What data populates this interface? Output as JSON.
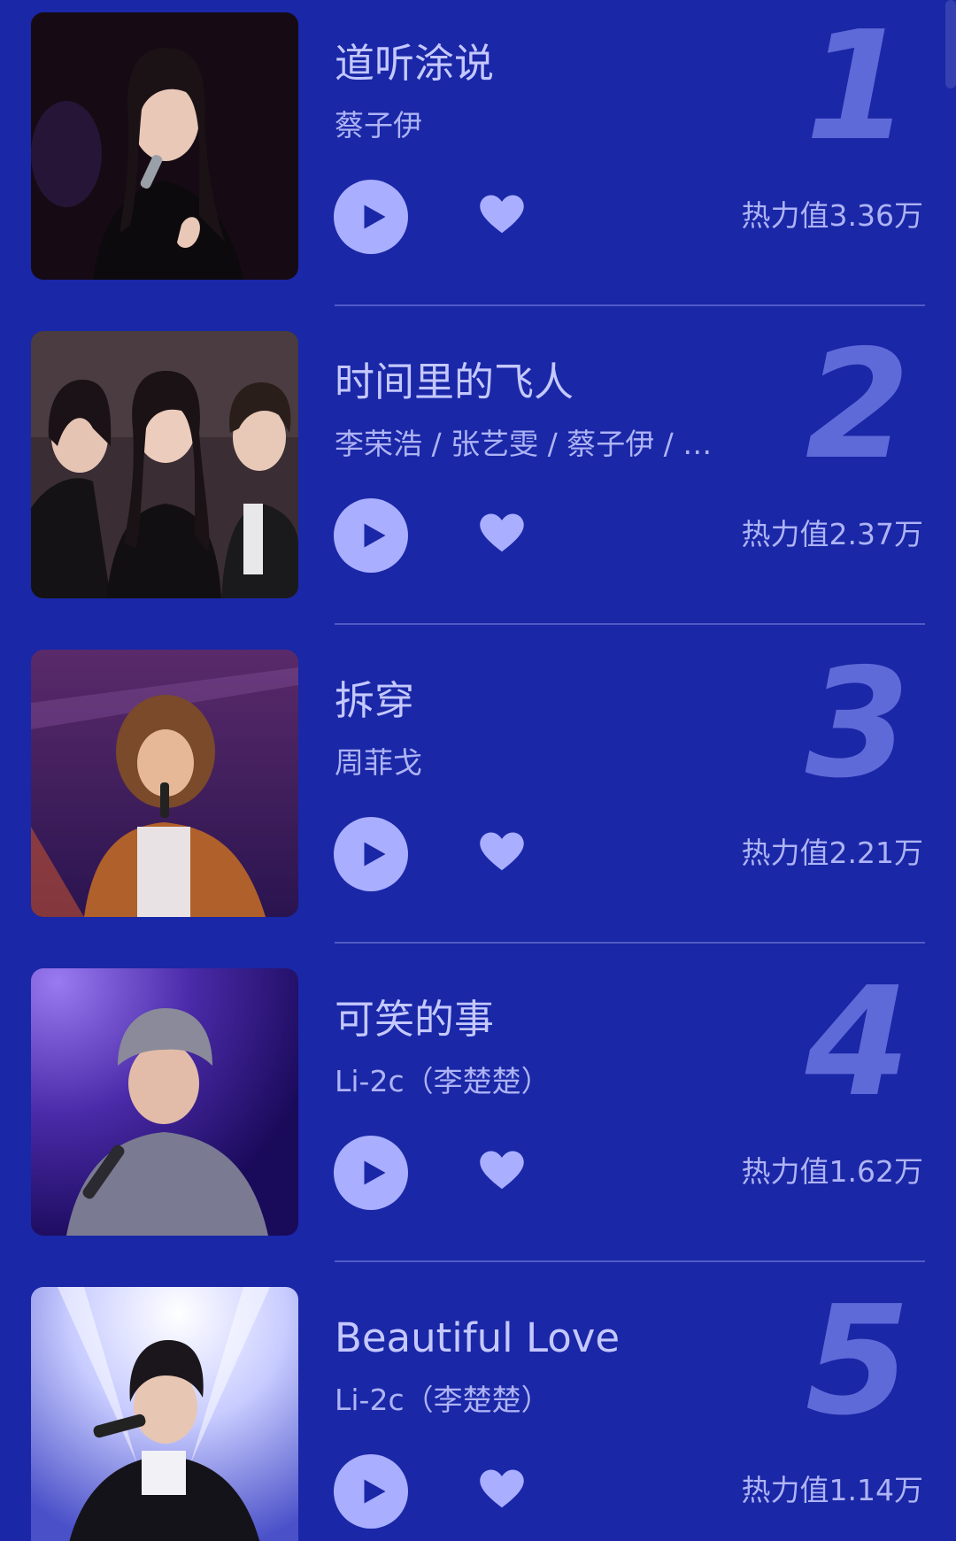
{
  "songs": [
    {
      "rank": "1",
      "title": "道听涂说",
      "artist": "蔡子伊",
      "heat": "热力值3.36万",
      "cover_theme": "dark"
    },
    {
      "rank": "2",
      "title": "时间里的飞人",
      "artist": "李荣浩 / 张艺雯 / 蔡子伊 / …",
      "heat": "热力值2.37万",
      "cover_theme": "group"
    },
    {
      "rank": "3",
      "title": "拆穿",
      "artist": "周菲戈",
      "heat": "热力值2.21万",
      "cover_theme": "stage"
    },
    {
      "rank": "4",
      "title": "可笑的事",
      "artist": "Li-2c（李楚楚）",
      "heat": "热力值1.62万",
      "cover_theme": "purple"
    },
    {
      "rank": "5",
      "title": "Beautiful Love",
      "artist": "Li-2c（李楚楚）",
      "heat": "热力值1.14万",
      "cover_theme": "light"
    }
  ],
  "icons": {
    "play": "play-icon",
    "like": "heart-icon"
  },
  "colors": {
    "background": "#1a27a6",
    "accent": "#a9aeff",
    "rank_number": "#5f6ad9",
    "text": "#c4c8ff"
  }
}
